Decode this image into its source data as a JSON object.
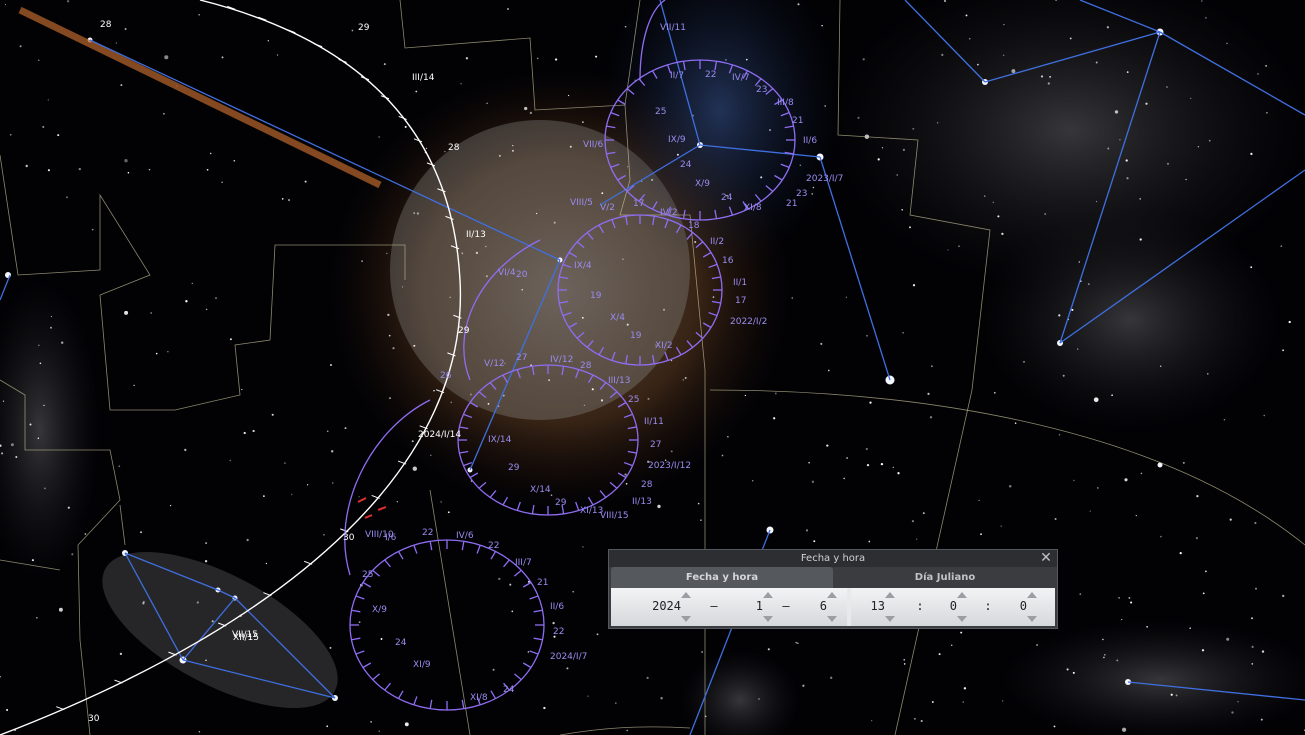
{
  "dialog": {
    "title": "Fecha y hora",
    "close_label": "✕",
    "tabs": [
      {
        "label": "Fecha y hora",
        "active": true
      },
      {
        "label": "Día Juliano",
        "active": false
      }
    ],
    "date": {
      "year": "2024",
      "month": "1",
      "day": "6",
      "separator": "–"
    },
    "time": {
      "hour": "13",
      "minute": "0",
      "second": "0",
      "separator": ":"
    }
  },
  "sky": {
    "labels": {
      "outer": [
        "28",
        "29",
        "III/14",
        "28",
        "II/13",
        "29",
        "2024/I/14",
        "VII/15",
        "30",
        "XII/15",
        "30"
      ],
      "upper_ring": [
        "VII/11",
        "II/7",
        "22",
        "IV/7",
        "23",
        "III/8",
        "21",
        "II/6",
        "VII/6",
        "25",
        "IX/9",
        "24",
        "2023/I/7",
        "23",
        "X/9",
        "24",
        "XI/8",
        "21"
      ],
      "mid_ring": [
        "VIII/5",
        "V/2",
        "17",
        "IV/2",
        "18",
        "II/2",
        "16",
        "II/1",
        "17",
        "2022/I/2",
        "VI/4",
        "20",
        "IX/4",
        "19",
        "X/4",
        "19",
        "XI/2"
      ],
      "lower_ring": [
        "V/12",
        "27",
        "IV/12",
        "28",
        "III/13",
        "25",
        "II/11",
        "27",
        "2023/I/12",
        "28",
        "II/13",
        "IX/14",
        "29",
        "X/14",
        "29",
        "XI/13",
        "VIII/15",
        "26"
      ],
      "bottom_ring": [
        "VIII/10",
        "I/6",
        "22",
        "IV/6",
        "22",
        "III/7",
        "21",
        "II/6",
        "22",
        "2024/I/7",
        "25",
        "X/9",
        "24",
        "XI/9",
        "XI/8",
        "24"
      ]
    },
    "colors": {
      "constellation_lines": "#3f6fe0",
      "boundaries": "#c8c29a",
      "outer_ring": "#ffffff",
      "purple_rings": "#8f6df2",
      "orange_line": "#b0622a"
    }
  }
}
